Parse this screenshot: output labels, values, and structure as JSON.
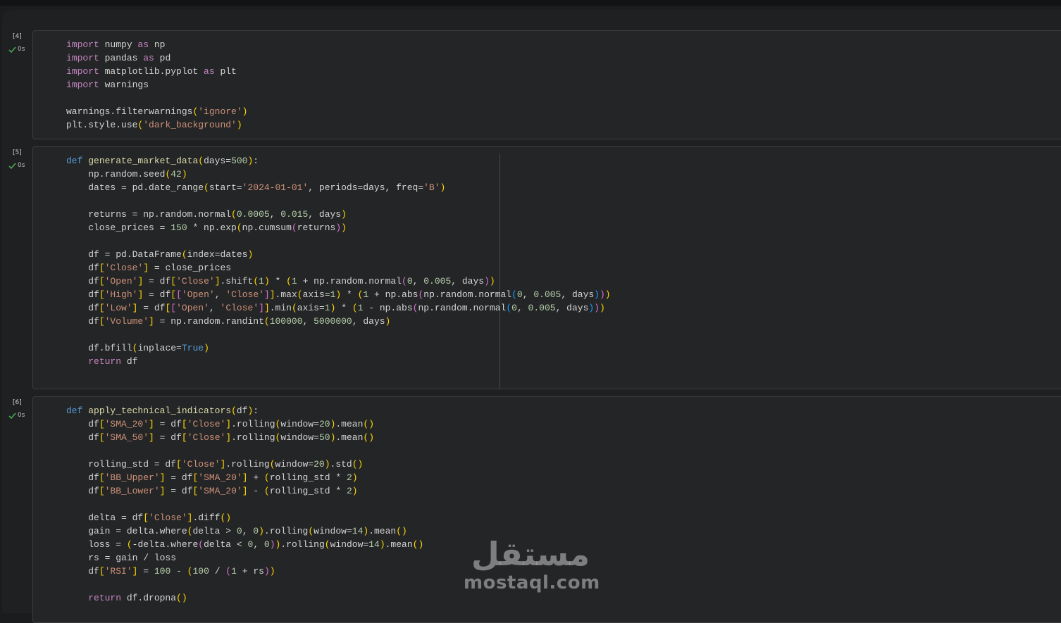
{
  "cells": [
    {
      "exec_count": "[4]",
      "status_time": "0s",
      "lines": [
        [
          [
            "imp",
            "import"
          ],
          [
            "",
            "  numpy "
          ],
          [
            "imp",
            "as"
          ],
          [
            "",
            " np"
          ]
        ],
        [
          [
            "imp",
            "import"
          ],
          [
            "",
            " pandas "
          ],
          [
            "imp",
            "as"
          ],
          [
            "",
            " pd"
          ]
        ],
        [
          [
            "imp",
            "import"
          ],
          [
            "",
            " matplotlib.pyplot "
          ],
          [
            "imp",
            "as"
          ],
          [
            "",
            " plt"
          ]
        ],
        [
          [
            "imp",
            "import"
          ],
          [
            "",
            " warnings"
          ]
        ],
        [],
        [
          [
            "",
            "warnings.filterwarnings"
          ],
          [
            "par",
            "("
          ],
          [
            "str",
            "'ignore'"
          ],
          [
            "par",
            ")"
          ]
        ],
        [
          [
            "",
            "plt.style.use"
          ],
          [
            "par",
            "("
          ],
          [
            "str",
            "'dark_background'"
          ],
          [
            "par",
            ")"
          ]
        ]
      ]
    },
    {
      "exec_count": "[5]",
      "status_time": "0s",
      "lines": [
        [
          [
            "kw",
            "def"
          ],
          [
            "",
            " "
          ],
          [
            "fn",
            "generate_market_data"
          ],
          [
            "par",
            "("
          ],
          [
            "",
            "days="
          ],
          [
            "num",
            "500"
          ],
          [
            "par",
            ")"
          ],
          [
            "",
            ":"
          ]
        ],
        [
          [
            "",
            "    np.random.seed"
          ],
          [
            "par",
            "("
          ],
          [
            "num",
            "42"
          ],
          [
            "par",
            ")"
          ]
        ],
        [
          [
            "",
            "    dates = pd.date_range"
          ],
          [
            "par",
            "("
          ],
          [
            "",
            "start="
          ],
          [
            "str",
            "'2024-01-01'"
          ],
          [
            "",
            ", periods=days, freq="
          ],
          [
            "str",
            "'B'"
          ],
          [
            "par",
            ")"
          ]
        ],
        [],
        [
          [
            "",
            "    returns = np.random.normal"
          ],
          [
            "par",
            "("
          ],
          [
            "num",
            "0.0005"
          ],
          [
            "",
            ", "
          ],
          [
            "num",
            "0.015"
          ],
          [
            "",
            ", days"
          ],
          [
            "par",
            ")"
          ]
        ],
        [
          [
            "",
            "    close_prices = "
          ],
          [
            "num",
            "150"
          ],
          [
            "",
            ", * np.exp"
          ],
          [
            "par",
            "("
          ],
          [
            "",
            "np.cumsum"
          ],
          [
            "pr2",
            "("
          ],
          [
            "",
            "returns"
          ],
          [
            "pr2",
            ")"
          ],
          [
            "par",
            ")"
          ]
        ],
        [],
        [
          [
            "",
            "    df = pd.DataFrame"
          ],
          [
            "par",
            "("
          ],
          [
            "",
            "index=dates"
          ],
          [
            "par",
            ")"
          ]
        ],
        [
          [
            "",
            "    df"
          ],
          [
            "par",
            "["
          ],
          [
            "str",
            "'Close'"
          ],
          [
            "par",
            "]"
          ],
          [
            "",
            ", = close_prices"
          ]
        ],
        [
          [
            "",
            "    df"
          ],
          [
            "par",
            "["
          ],
          [
            "str",
            "'Open'"
          ],
          [
            "par",
            "]"
          ],
          [
            "",
            ", = df"
          ],
          [
            "par",
            "["
          ],
          [
            "str",
            "'Close'"
          ],
          [
            "par",
            "]"
          ],
          [
            "",
            ".shift"
          ],
          [
            "par",
            "("
          ],
          [
            "num",
            "1"
          ],
          [
            "par",
            ")"
          ],
          [
            "",
            ", * "
          ],
          [
            "par",
            "("
          ],
          [
            "num",
            "1"
          ],
          [
            "",
            ", + np.random.normal"
          ],
          [
            "pr2",
            "("
          ],
          [
            "num",
            "0"
          ],
          [
            "",
            ", "
          ],
          [
            "num",
            "0.005"
          ],
          [
            "",
            ", days"
          ],
          [
            "pr2",
            ")"
          ],
          [
            "par",
            ")"
          ]
        ],
        [
          [
            "",
            "    df"
          ],
          [
            "par",
            "["
          ],
          [
            "str",
            "'High'"
          ],
          [
            "par",
            "]"
          ],
          [
            "",
            ", = df"
          ],
          [
            "par",
            "["
          ],
          [
            "pr2",
            "["
          ],
          [
            "str",
            "'Open'"
          ],
          [
            "",
            ", "
          ],
          [
            "str",
            "'Close'"
          ],
          [
            "pr2",
            "]"
          ],
          [
            "par",
            "]"
          ],
          [
            "",
            ".max"
          ],
          [
            "par",
            "("
          ],
          [
            "",
            "axis="
          ],
          [
            "num",
            "1"
          ],
          [
            "par",
            ")"
          ],
          [
            "",
            ", * "
          ],
          [
            "par",
            "("
          ],
          [
            "num",
            "1"
          ],
          [
            "",
            ", + np.abs"
          ],
          [
            "pr2",
            "("
          ],
          [
            "",
            "np.random.normal"
          ],
          [
            "pr3",
            "("
          ],
          [
            "num",
            "0"
          ],
          [
            "",
            ", "
          ],
          [
            "num",
            "0.005"
          ],
          [
            "",
            ", days"
          ],
          [
            "pr3",
            ")"
          ],
          [
            "pr2",
            ")"
          ],
          [
            "par",
            ")"
          ]
        ],
        [
          [
            "",
            "    df"
          ],
          [
            "par",
            "["
          ],
          [
            "str",
            "'Low'"
          ],
          [
            "par",
            "]"
          ],
          [
            "",
            ", = df"
          ],
          [
            "par",
            "["
          ],
          [
            "pr2",
            "["
          ],
          [
            "str",
            "'Open'"
          ],
          [
            "",
            ", "
          ],
          [
            "str",
            "'Close'"
          ],
          [
            "pr2",
            "]"
          ],
          [
            "par",
            "]"
          ],
          [
            "",
            ".min"
          ],
          [
            "par",
            "("
          ],
          [
            "",
            "axis="
          ],
          [
            "num",
            "1"
          ],
          [
            "par",
            ")"
          ],
          [
            "",
            ", * "
          ],
          [
            "par",
            "("
          ],
          [
            "num",
            "1"
          ],
          [
            "",
            ", - np.abs"
          ],
          [
            "pr2",
            "("
          ],
          [
            "",
            "np.random.normal"
          ],
          [
            "pr3",
            "("
          ],
          [
            "num",
            "0"
          ],
          [
            "",
            ", "
          ],
          [
            "num",
            "0.005"
          ],
          [
            "",
            ", days"
          ],
          [
            "pr3",
            ")"
          ],
          [
            "pr2",
            ")"
          ],
          [
            "par",
            ")"
          ]
        ],
        [
          [
            "",
            "    df"
          ],
          [
            "par",
            "["
          ],
          [
            "str",
            "'Volume'"
          ],
          [
            "par",
            "]"
          ],
          [
            "",
            ", = np.random.randint"
          ],
          [
            "par",
            "("
          ],
          [
            "num",
            "100000"
          ],
          [
            "",
            ", "
          ],
          [
            "num",
            "5000000"
          ],
          [
            "",
            ", days"
          ],
          [
            "par",
            ")"
          ]
        ],
        [],
        [
          [
            "",
            "    df.bfill"
          ],
          [
            "par",
            "("
          ],
          [
            "",
            "inplace="
          ],
          [
            "kw",
            "True"
          ],
          [
            "par",
            ")"
          ]
        ],
        [
          [
            "imp",
            "    return"
          ],
          [
            "",
            " df"
          ]
        ]
      ]
    },
    {
      "exec_count": "[6]",
      "status_time": "0s",
      "lines": [
        [
          [
            "kw",
            "def"
          ],
          [
            "",
            " "
          ],
          [
            "fn",
            "apply_technical_indicators"
          ],
          [
            "par",
            "("
          ],
          [
            "",
            "df"
          ],
          [
            "par",
            ")"
          ],
          [
            "",
            ":"
          ]
        ],
        [
          [
            "",
            "    df"
          ],
          [
            "par",
            "["
          ],
          [
            "str",
            "'SMA_20'"
          ],
          [
            "par",
            "]"
          ],
          [
            "",
            ", = df"
          ],
          [
            "par",
            "["
          ],
          [
            "str",
            "'Close'"
          ],
          [
            "par",
            "]"
          ],
          [
            "",
            ".rolling"
          ],
          [
            "par",
            "("
          ],
          [
            "",
            "window="
          ],
          [
            "num",
            "20"
          ],
          [
            "par",
            ")"
          ],
          [
            "",
            ".mean"
          ],
          [
            "par",
            "()"
          ]
        ],
        [
          [
            "",
            "    df"
          ],
          [
            "par",
            "["
          ],
          [
            "str",
            "'SMA_50'"
          ],
          [
            "par",
            "]"
          ],
          [
            "",
            ", = df"
          ],
          [
            "par",
            "["
          ],
          [
            "str",
            "'Close'"
          ],
          [
            "par",
            "]"
          ],
          [
            "",
            ".rolling"
          ],
          [
            "par",
            "("
          ],
          [
            "",
            "window="
          ],
          [
            "num",
            "50"
          ],
          [
            "par",
            ")"
          ],
          [
            "",
            ".mean"
          ],
          [
            "par",
            "()"
          ]
        ],
        [],
        [
          [
            "",
            "    rolling_std = df"
          ],
          [
            "par",
            "["
          ],
          [
            "str",
            "'Close'"
          ],
          [
            "par",
            "]"
          ],
          [
            "",
            ".rolling"
          ],
          [
            "par",
            "("
          ],
          [
            "",
            "window="
          ],
          [
            "num",
            "20"
          ],
          [
            "par",
            ")"
          ],
          [
            "",
            ".std"
          ],
          [
            "par",
            "()"
          ]
        ],
        [
          [
            "",
            "    df"
          ],
          [
            "par",
            "["
          ],
          [
            "str",
            "'BB_Upper'"
          ],
          [
            "par",
            "]"
          ],
          [
            "",
            ", = df"
          ],
          [
            "par",
            "["
          ],
          [
            "str",
            "'SMA_20'"
          ],
          [
            "par",
            "]"
          ],
          [
            "",
            ", + "
          ],
          [
            "par",
            "("
          ],
          [
            "",
            "rolling_std * "
          ],
          [
            "num",
            "2"
          ],
          [
            "par",
            ")"
          ]
        ],
        [
          [
            "",
            "    df"
          ],
          [
            "par",
            "["
          ],
          [
            "str",
            "'BB_Lower'"
          ],
          [
            "par",
            "]"
          ],
          [
            "",
            ", = df"
          ],
          [
            "par",
            "["
          ],
          [
            "str",
            "'SMA_20'"
          ],
          [
            "par",
            "]"
          ],
          [
            "",
            ", - "
          ],
          [
            "par",
            "("
          ],
          [
            "",
            "rolling_std * "
          ],
          [
            "num",
            "2"
          ],
          [
            "par",
            ")"
          ]
        ],
        [],
        [
          [
            "",
            "    delta = df"
          ],
          [
            "par",
            "["
          ],
          [
            "str",
            "'Close'"
          ],
          [
            "par",
            "]"
          ],
          [
            "",
            ".diff"
          ],
          [
            "par",
            "()"
          ]
        ],
        [
          [
            "",
            "    gain = delta.where"
          ],
          [
            "par",
            "("
          ],
          [
            "",
            "delta > "
          ],
          [
            "num",
            "0"
          ],
          [
            "",
            ", "
          ],
          [
            "num",
            "0"
          ],
          [
            "par",
            ")"
          ],
          [
            "",
            ".rolling"
          ],
          [
            "par",
            "("
          ],
          [
            "",
            "window="
          ],
          [
            "num",
            "14"
          ],
          [
            "par",
            ")"
          ],
          [
            "",
            ".mean"
          ],
          [
            "par",
            "()"
          ]
        ],
        [
          [
            "",
            "    loss = "
          ],
          [
            "par",
            "("
          ],
          [
            "",
            "-delta.where"
          ],
          [
            "pr2",
            "("
          ],
          [
            "",
            "delta < "
          ],
          [
            "num",
            "0"
          ],
          [
            "",
            ", "
          ],
          [
            "num",
            "0"
          ],
          [
            "pr2",
            ")"
          ],
          [
            "par",
            ")"
          ],
          [
            "",
            ".rolling"
          ],
          [
            "par",
            "("
          ],
          [
            "",
            "window="
          ],
          [
            "num",
            "14"
          ],
          [
            "par",
            ")"
          ],
          [
            "",
            ".mean"
          ],
          [
            "par",
            "()"
          ]
        ],
        [
          [
            "",
            "    rs = gain / loss"
          ]
        ],
        [
          [
            "",
            "    df"
          ],
          [
            "par",
            "["
          ],
          [
            "str",
            "'RSI'"
          ],
          [
            "par",
            "]"
          ],
          [
            "",
            ", = "
          ],
          [
            "num",
            "100"
          ],
          [
            "",
            ", - "
          ],
          [
            "par",
            "("
          ],
          [
            "num",
            "100"
          ],
          [
            "",
            ", / "
          ],
          [
            "pr2",
            "("
          ],
          [
            "num",
            "1"
          ],
          [
            "",
            ", + rs"
          ],
          [
            "pr2",
            ")"
          ],
          [
            "par",
            ")"
          ]
        ],
        [],
        [
          [
            "imp",
            "    return"
          ],
          [
            "",
            " df.dropna"
          ],
          [
            "par",
            "()"
          ]
        ]
      ]
    }
  ],
  "watermark": {
    "arabic": "مستقل",
    "latin": "mostaql.com"
  },
  "colors": {
    "background": "#1f2022",
    "editor": "#242527",
    "check": "#4caf50"
  }
}
